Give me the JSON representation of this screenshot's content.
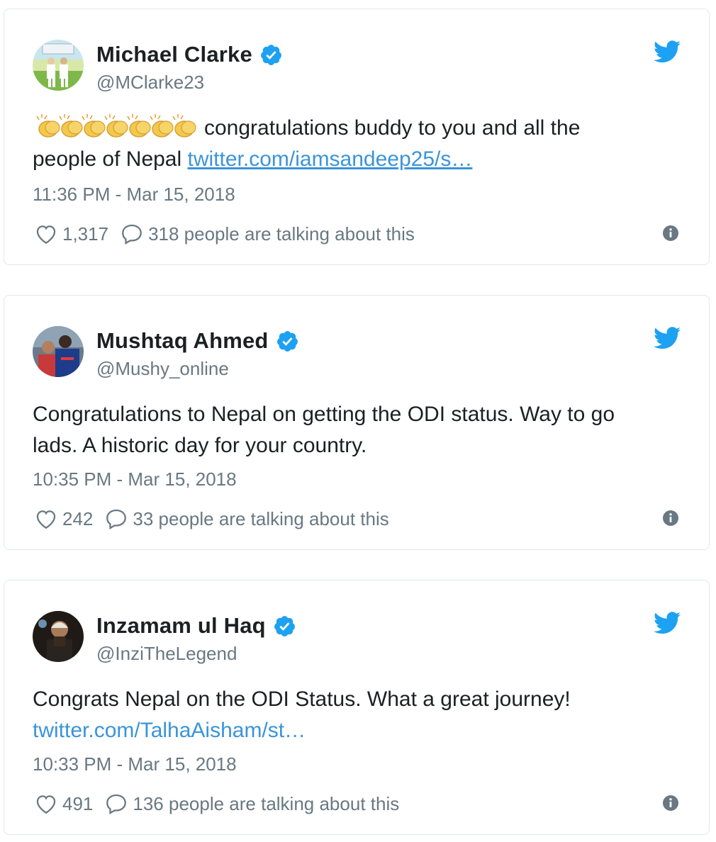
{
  "tweets": [
    {
      "name": "Michael Clarke",
      "handle": "@MClarke23",
      "emoji": "👏👏👏👏👏👏👏",
      "text_line1": "congratulations buddy to you and all the",
      "text_line2": "people of Nepal",
      "link": "twitter.com/iamsandeep25/s…",
      "timestamp": "11:36 PM - Mar 15, 2018",
      "likes": "1,317",
      "talking": "318 people are talking about this"
    },
    {
      "name": "Mushtaq Ahmed",
      "handle": "@Mushy_online",
      "text_line1": "Congratulations to Nepal on getting the ODI status. Way to go",
      "text_line2": "lads. A historic day for your country.",
      "timestamp": "10:35 PM - Mar 15, 2018",
      "likes": "242",
      "talking": "33 people are talking about this"
    },
    {
      "name": "Inzamam ul Haq",
      "handle": "@InziTheLegend",
      "text_line1": "Congrats Nepal on the ODI Status. What a great journey!",
      "link": "twitter.com/TalhaAisham/st…",
      "timestamp": "10:33 PM - Mar 15, 2018",
      "likes": "491",
      "talking": "136 people are talking about this"
    }
  ],
  "colors": {
    "verified": "#1da1f2",
    "link": "#3b94d9",
    "muted": "#697882",
    "border": "#e1e8ed"
  },
  "icons": [
    "verified-badge-icon",
    "twitter-bird-icon",
    "heart-icon",
    "reply-bubble-icon",
    "info-icon"
  ]
}
